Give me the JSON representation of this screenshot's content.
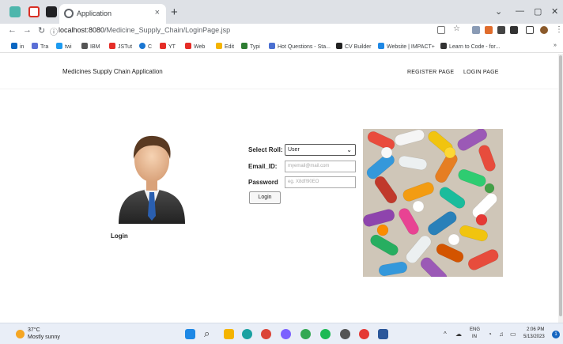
{
  "browser": {
    "tab_title": "Application",
    "tab_close": "×",
    "new_tab": "+",
    "url_host": "localhost:8080",
    "url_path": "/Medicine_Supply_Chain/LoginPage.jsp",
    "bookmarks": [
      "in",
      "Tra",
      "twi",
      "IBM",
      "JSTut",
      "C",
      "YT",
      "Web",
      "Edit",
      "Typi",
      "Hot Questions - Sta...",
      "CV Builder",
      "Website | IMPACT+",
      "Learn to Code - for..."
    ],
    "bookmarks_more": "»"
  },
  "app": {
    "title": "Medicines Supply Chain Application",
    "nav": {
      "register": "REGISTER PAGE",
      "login": "LOGIN PAGE"
    },
    "login_caption": "Login"
  },
  "form": {
    "role_label": "Select Roll:",
    "role_value": "User",
    "email_label": "Email_ID:",
    "email_placeholder": "myemail@mail.com",
    "password_label": "Password",
    "password_placeholder": "eg. X8df!90EO",
    "submit_label": "Login"
  },
  "taskbar": {
    "temperature": "37°C",
    "weather": "Mostly sunny",
    "lang_top": "ENG",
    "lang_bottom": "IN",
    "time": "2:06 PM",
    "date": "5/13/2023"
  }
}
